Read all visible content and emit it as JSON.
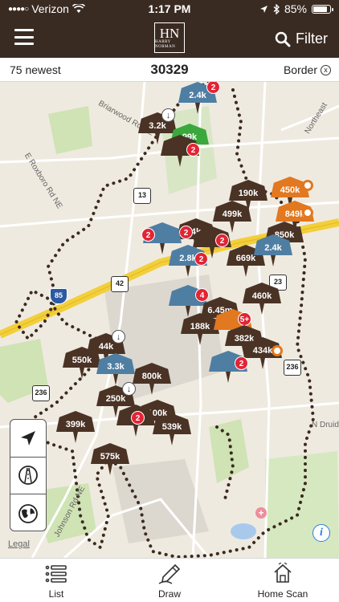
{
  "status_bar": {
    "carrier": "Verizon",
    "time": "1:17 PM",
    "battery": "85%",
    "battery_level": 0.85
  },
  "header": {
    "logo_mono": "HN",
    "logo_name": "HARRY NORMAN",
    "filter_label": "Filter"
  },
  "subheader": {
    "sort_label": "75 newest",
    "zip": "30329",
    "border_label": "Border",
    "border_close": "x"
  },
  "map": {
    "road_labels": [
      "Briarwood Rd NE",
      "E Roxboro Rd NE",
      "Johnson Rd NE",
      "N Druid",
      "Northeast"
    ],
    "shields": [
      "13",
      "42",
      "23",
      "236",
      "236",
      "85"
    ],
    "legal": "Legal",
    "info": "i",
    "hospital": "+",
    "listings": [
      {
        "price": "2.4k",
        "color": "blue",
        "badge": "2"
      },
      {
        "price": "3.2k",
        "color": "brown",
        "badge": "↓"
      },
      {
        "price": "99k",
        "color": "green",
        "badge": ""
      },
      {
        "price": "",
        "color": "brown",
        "badge": "2"
      },
      {
        "price": "190k",
        "color": "brown",
        "badge": ""
      },
      {
        "price": "450k",
        "color": "orange",
        "badge": ""
      },
      {
        "price": "499k",
        "color": "brown",
        "badge": ""
      },
      {
        "price": "849k",
        "color": "orange",
        "badge": ""
      },
      {
        "price": "850k",
        "color": "brown",
        "badge": ""
      },
      {
        "price": "4k",
        "color": "brown",
        "badge": "2"
      },
      {
        "price": "",
        "color": "blue",
        "badge": "2"
      },
      {
        "price": "",
        "color": "brown",
        "badge": "2"
      },
      {
        "price": "2.8k",
        "color": "blue",
        "badge": "2"
      },
      {
        "price": "669k",
        "color": "brown",
        "badge": ""
      },
      {
        "price": "2.4k",
        "color": "blue",
        "badge": ""
      },
      {
        "price": "460k",
        "color": "brown",
        "badge": ""
      },
      {
        "price": "",
        "color": "blue",
        "badge": "4"
      },
      {
        "price": "6.45m",
        "color": "brown",
        "badge": ""
      },
      {
        "price": "188k",
        "color": "brown",
        "badge": ""
      },
      {
        "price": "",
        "color": "orange",
        "badge": "5+"
      },
      {
        "price": "382k",
        "color": "brown",
        "badge": ""
      },
      {
        "price": "434k",
        "color": "brown",
        "badge": ""
      },
      {
        "price": "",
        "color": "blue",
        "badge": "2"
      },
      {
        "price": "550k",
        "color": "brown",
        "badge": ""
      },
      {
        "price": "44k",
        "color": "brown",
        "badge": "↓"
      },
      {
        "price": "3.3k",
        "color": "blue",
        "badge": ""
      },
      {
        "price": "800k",
        "color": "brown",
        "badge": ""
      },
      {
        "price": "250k",
        "color": "brown",
        "badge": "↓"
      },
      {
        "price": "100k",
        "color": "brown",
        "badge": ""
      },
      {
        "price": "",
        "color": "brown",
        "badge": "2"
      },
      {
        "price": "399k",
        "color": "brown",
        "badge": ""
      },
      {
        "price": "539k",
        "color": "brown",
        "badge": ""
      },
      {
        "price": "575k",
        "color": "brown",
        "badge": ""
      }
    ]
  },
  "map_tools": [
    {
      "name": "locate-icon"
    },
    {
      "name": "road-view-icon"
    },
    {
      "name": "globe-icon"
    }
  ],
  "tabs": {
    "list": "List",
    "draw": "Draw",
    "home_scan": "Home Scan"
  },
  "colors": {
    "brand_brown": "#3a2b22",
    "pin_brown": "#4a3325",
    "pin_blue": "#4f7ea3",
    "pin_orange": "#e2781f",
    "pin_green": "#3aa83c",
    "badge_red": "#e32434"
  }
}
